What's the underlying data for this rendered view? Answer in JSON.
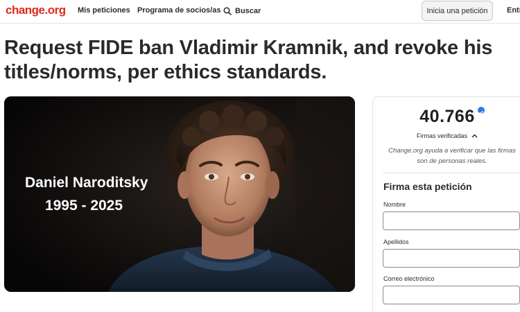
{
  "nav": {
    "logo": "change.org",
    "my_petitions": "Mis peticiones",
    "partners": "Programa de socios/as",
    "search_label": "Buscar",
    "start_petition": "Inicia una petición",
    "login": "Entr"
  },
  "petition": {
    "title": "Request FIDE ban Vladimir Kramnik, and revoke his titles/norms, per ethics standards.",
    "image": {
      "name": "Daniel Naroditsky",
      "years": "1995 - 2025"
    }
  },
  "signatures": {
    "count": "40.766",
    "verified_label": "Firmas verificadas",
    "help_text": "Change.org ayuda a verificar que las firmas son de personas reales."
  },
  "form": {
    "title": "Firma esta petición",
    "first_name_label": "Nombre",
    "first_name_value": "",
    "last_name_label": "Apellidos",
    "last_name_value": "",
    "email_label": "Correo electrónico",
    "email_value": ""
  },
  "colors": {
    "brand": "#e02a1f",
    "verified": "#2d7be5"
  }
}
